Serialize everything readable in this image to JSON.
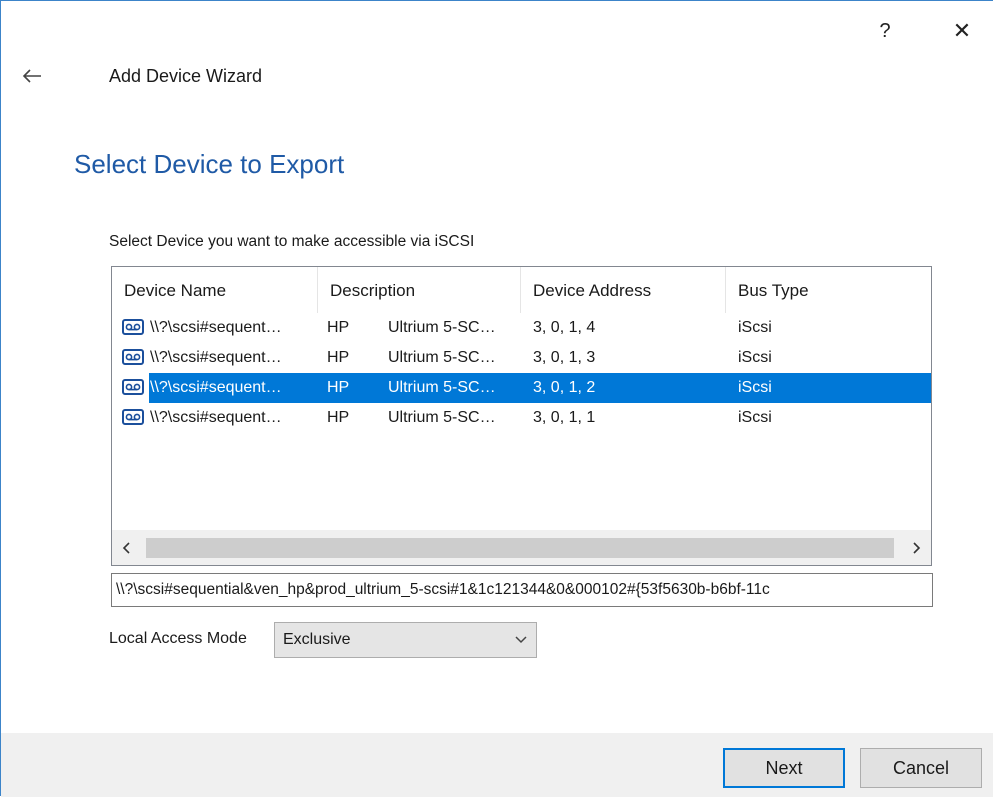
{
  "window": {
    "help_label": "?",
    "close_label": "✕",
    "wizard_title": "Add Device Wizard"
  },
  "page": {
    "title": "Select Device to Export",
    "instruction": "Select Device you want to make accessible via iSCSI"
  },
  "device_list": {
    "columns": [
      "Device Name",
      "Description",
      "Device Address",
      "Bus Type"
    ],
    "rows": [
      {
        "name": "\\\\?\\scsi#sequent…",
        "vendor": "HP",
        "description": "Ultrium 5-SC…",
        "address": "3, 0, 1, 4",
        "bus": "iScsi",
        "selected": false
      },
      {
        "name": "\\\\?\\scsi#sequent…",
        "vendor": "HP",
        "description": "Ultrium 5-SC…",
        "address": "3, 0, 1, 3",
        "bus": "iScsi",
        "selected": false
      },
      {
        "name": "\\\\?\\scsi#sequent…",
        "vendor": "HP",
        "description": "Ultrium 5-SC…",
        "address": "3, 0, 1, 2",
        "bus": "iScsi",
        "selected": true
      },
      {
        "name": "\\\\?\\scsi#sequent…",
        "vendor": "HP",
        "description": "Ultrium 5-SC…",
        "address": "3, 0, 1, 1",
        "bus": "iScsi",
        "selected": false
      }
    ],
    "scroll_left": "‹",
    "scroll_right": "›"
  },
  "device_path": "\\\\?\\scsi#sequential&ven_hp&prod_ultrium_5-scsi#1&1c121344&0&000102#{53f5630b-b6bf-11c",
  "access": {
    "label": "Local Access Mode",
    "value": "Exclusive"
  },
  "buttons": {
    "next": "Next",
    "cancel": "Cancel"
  },
  "colors": {
    "accent": "#0078d7",
    "title": "#1f5aa6",
    "tape_icon": "#1b4f9c"
  },
  "icons": {
    "back": "back-arrow-icon",
    "device": "tape-drive-icon",
    "dropdown": "chevron-down-icon"
  }
}
